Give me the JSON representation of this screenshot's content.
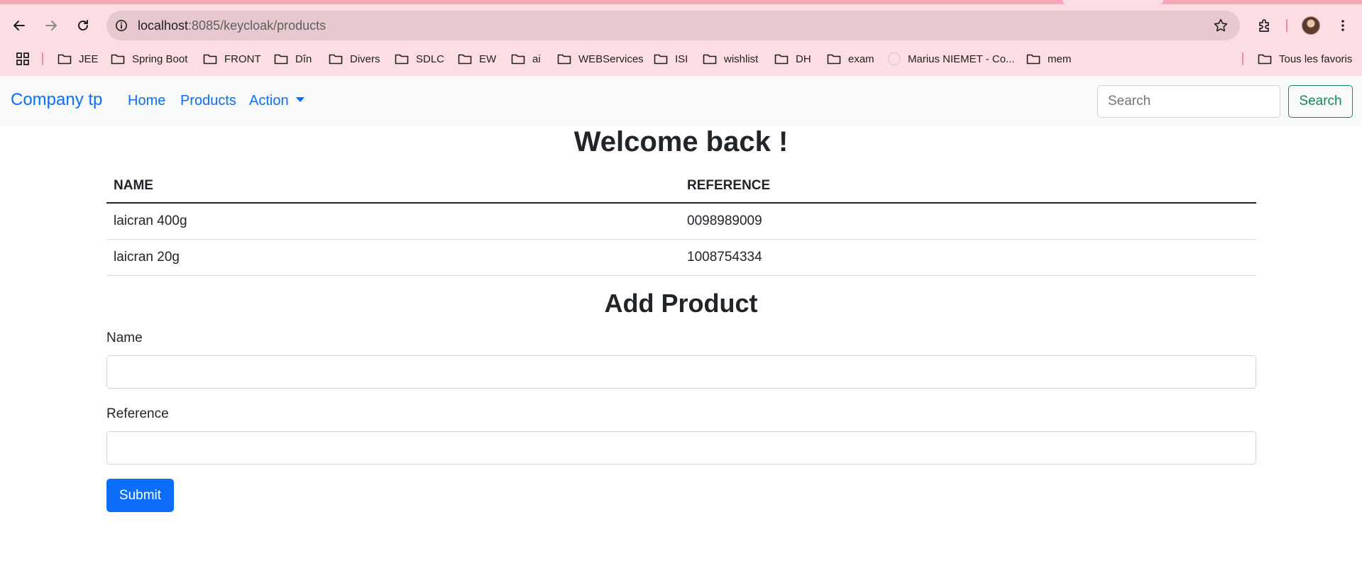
{
  "browser": {
    "url_host": "localhost",
    "url_rest": ":8085/keycloak/products",
    "bookmarks": [
      {
        "label": "JEE",
        "icon": "folder-icon"
      },
      {
        "label": "Spring Boot",
        "icon": "folder-icon"
      },
      {
        "label": "FRONT",
        "icon": "folder-icon"
      },
      {
        "label": "Dîn",
        "icon": "folder-icon"
      },
      {
        "label": "Divers",
        "icon": "folder-icon"
      },
      {
        "label": "SDLC",
        "icon": "folder-icon"
      },
      {
        "label": "EW",
        "icon": "folder-icon"
      },
      {
        "label": "ai",
        "icon": "folder-icon"
      },
      {
        "label": "WEBServices",
        "icon": "folder-icon"
      },
      {
        "label": "ISI",
        "icon": "folder-icon"
      },
      {
        "label": "wishlist",
        "icon": "folder-icon"
      },
      {
        "label": "DH",
        "icon": "folder-icon"
      },
      {
        "label": "exam",
        "icon": "folder-icon"
      },
      {
        "label": "Marius NIEMET - Co...",
        "icon": "globe-icon"
      },
      {
        "label": "mem",
        "icon": "folder-icon"
      }
    ],
    "all_bookmarks_label": "Tous les favoris"
  },
  "navbar": {
    "brand": "Company tp",
    "links": [
      "Home",
      "Products",
      "Action"
    ],
    "search_placeholder": "Search",
    "search_button": "Search"
  },
  "main": {
    "welcome": "Welcome back !",
    "table": {
      "headers": [
        "NAME",
        "REFERENCE"
      ],
      "rows": [
        [
          "laicran 400g",
          "0098989009"
        ],
        [
          "laicran 20g",
          "1008754334"
        ]
      ]
    },
    "form": {
      "title": "Add Product",
      "name_label": "Name",
      "reference_label": "Reference",
      "submit_label": "Submit"
    }
  },
  "colors": {
    "primary": "#0d6efd",
    "success": "#198754",
    "chrome_bg": "#fddde4"
  }
}
